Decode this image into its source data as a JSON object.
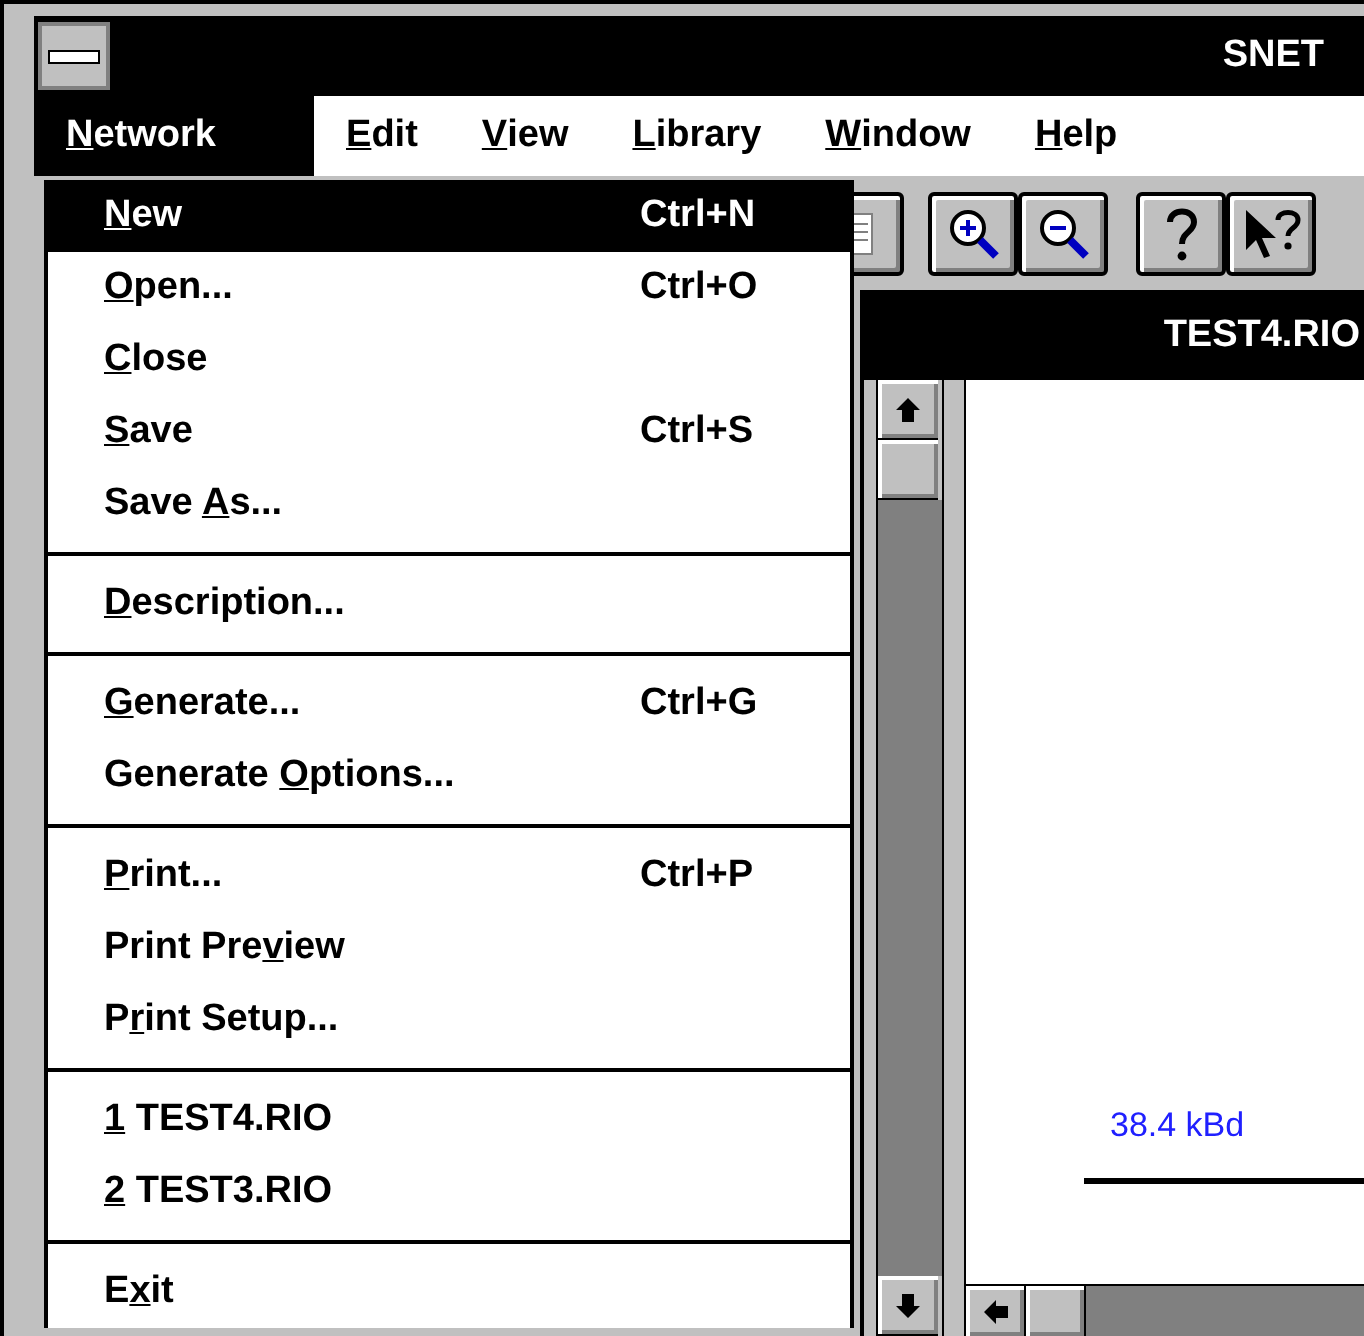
{
  "window": {
    "title": "SNET"
  },
  "menu_bar": [
    {
      "parts": [
        {
          "text": "N",
          "underline": true
        },
        {
          "text": "etwork",
          "underline": false
        }
      ],
      "selected": true
    },
    {
      "parts": [
        {
          "text": "E",
          "underline": true
        },
        {
          "text": "dit",
          "underline": false
        }
      ],
      "selected": false
    },
    {
      "parts": [
        {
          "text": "V",
          "underline": true
        },
        {
          "text": "iew",
          "underline": false
        }
      ],
      "selected": false
    },
    {
      "parts": [
        {
          "text": "L",
          "underline": true
        },
        {
          "text": "ibrary",
          "underline": false
        }
      ],
      "selected": false
    },
    {
      "parts": [
        {
          "text": "W",
          "underline": true
        },
        {
          "text": "indow",
          "underline": false
        }
      ],
      "selected": false
    },
    {
      "parts": [
        {
          "text": "H",
          "underline": true
        },
        {
          "text": "elp",
          "underline": false
        }
      ],
      "selected": false
    }
  ],
  "toolbar": [
    {
      "kind": "document"
    },
    {
      "kind": "zoom-in"
    },
    {
      "kind": "zoom-out"
    },
    {
      "kind": "help"
    },
    {
      "kind": "context-help"
    }
  ],
  "document": {
    "title": "TEST4.RIO",
    "link_label": "38.4 kBd"
  },
  "dropdown": [
    {
      "kind": "item",
      "parts": [
        {
          "text": "N",
          "underline": true
        },
        {
          "text": "ew",
          "underline": false
        }
      ],
      "shortcut": "Ctrl+N",
      "selected": true
    },
    {
      "kind": "item",
      "parts": [
        {
          "text": "O",
          "underline": true
        },
        {
          "text": "pen...",
          "underline": false
        }
      ],
      "shortcut": "Ctrl+O",
      "selected": false
    },
    {
      "kind": "item",
      "parts": [
        {
          "text": "C",
          "underline": true
        },
        {
          "text": "lose",
          "underline": false
        }
      ],
      "selected": false
    },
    {
      "kind": "item",
      "parts": [
        {
          "text": "S",
          "underline": true
        },
        {
          "text": "ave",
          "underline": false
        }
      ],
      "shortcut": "Ctrl+S",
      "selected": false
    },
    {
      "kind": "item",
      "parts": [
        {
          "text": "Save ",
          "underline": false
        },
        {
          "text": "A",
          "underline": true
        },
        {
          "text": "s...",
          "underline": false
        }
      ],
      "selected": false
    },
    {
      "kind": "separator"
    },
    {
      "kind": "item",
      "parts": [
        {
          "text": "D",
          "underline": true
        },
        {
          "text": "escription...",
          "underline": false
        }
      ],
      "selected": false
    },
    {
      "kind": "separator"
    },
    {
      "kind": "item",
      "parts": [
        {
          "text": "G",
          "underline": true
        },
        {
          "text": "enerate...",
          "underline": false
        }
      ],
      "shortcut": "Ctrl+G",
      "selected": false
    },
    {
      "kind": "item",
      "parts": [
        {
          "text": "Generate ",
          "underline": false
        },
        {
          "text": "O",
          "underline": true
        },
        {
          "text": "ptions...",
          "underline": false
        }
      ],
      "selected": false
    },
    {
      "kind": "separator"
    },
    {
      "kind": "item",
      "parts": [
        {
          "text": "P",
          "underline": true
        },
        {
          "text": "rint...",
          "underline": false
        }
      ],
      "shortcut": "Ctrl+P",
      "selected": false
    },
    {
      "kind": "item",
      "parts": [
        {
          "text": "Print Pre",
          "underline": false
        },
        {
          "text": "v",
          "underline": true
        },
        {
          "text": "iew",
          "underline": false
        }
      ],
      "selected": false
    },
    {
      "kind": "item",
      "parts": [
        {
          "text": "P",
          "underline": false
        },
        {
          "text": "r",
          "underline": true
        },
        {
          "text": "int Setup...",
          "underline": false
        }
      ],
      "selected": false
    },
    {
      "kind": "separator"
    },
    {
      "kind": "item",
      "parts": [
        {
          "text": "1",
          "underline": true
        },
        {
          "text": " TEST4.RIO",
          "underline": false
        }
      ],
      "selected": false
    },
    {
      "kind": "item",
      "parts": [
        {
          "text": "2",
          "underline": true
        },
        {
          "text": " TEST3.RIO",
          "underline": false
        }
      ],
      "selected": false
    },
    {
      "kind": "separator"
    },
    {
      "kind": "item",
      "parts": [
        {
          "text": "E",
          "underline": false
        },
        {
          "text": "x",
          "underline": true
        },
        {
          "text": "it",
          "underline": false
        }
      ],
      "selected": false
    }
  ]
}
